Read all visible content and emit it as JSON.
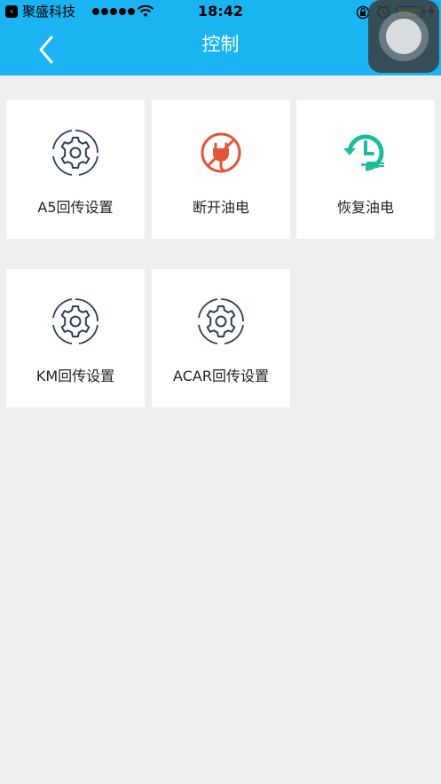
{
  "status_bar": {
    "back_app": "聚盛科技",
    "time": "18:42"
  },
  "nav": {
    "title": "控制"
  },
  "tiles": [
    {
      "label": "A5回传设置",
      "icon": "gear-icon",
      "color": "#2c3e5a"
    },
    {
      "label": "断开油电",
      "icon": "power-off-icon",
      "color": "#e2553b"
    },
    {
      "label": "恢复油电",
      "icon": "power-restore-icon",
      "color": "#1ebc9c"
    },
    {
      "label": "KM回传设置",
      "icon": "gear-icon",
      "color": "#2c3e5a"
    },
    {
      "label": "ACAR回传设置",
      "icon": "gear-icon",
      "color": "#2c3e5a"
    }
  ],
  "colors": {
    "header": "#1bb4f3",
    "background": "#efefef"
  }
}
